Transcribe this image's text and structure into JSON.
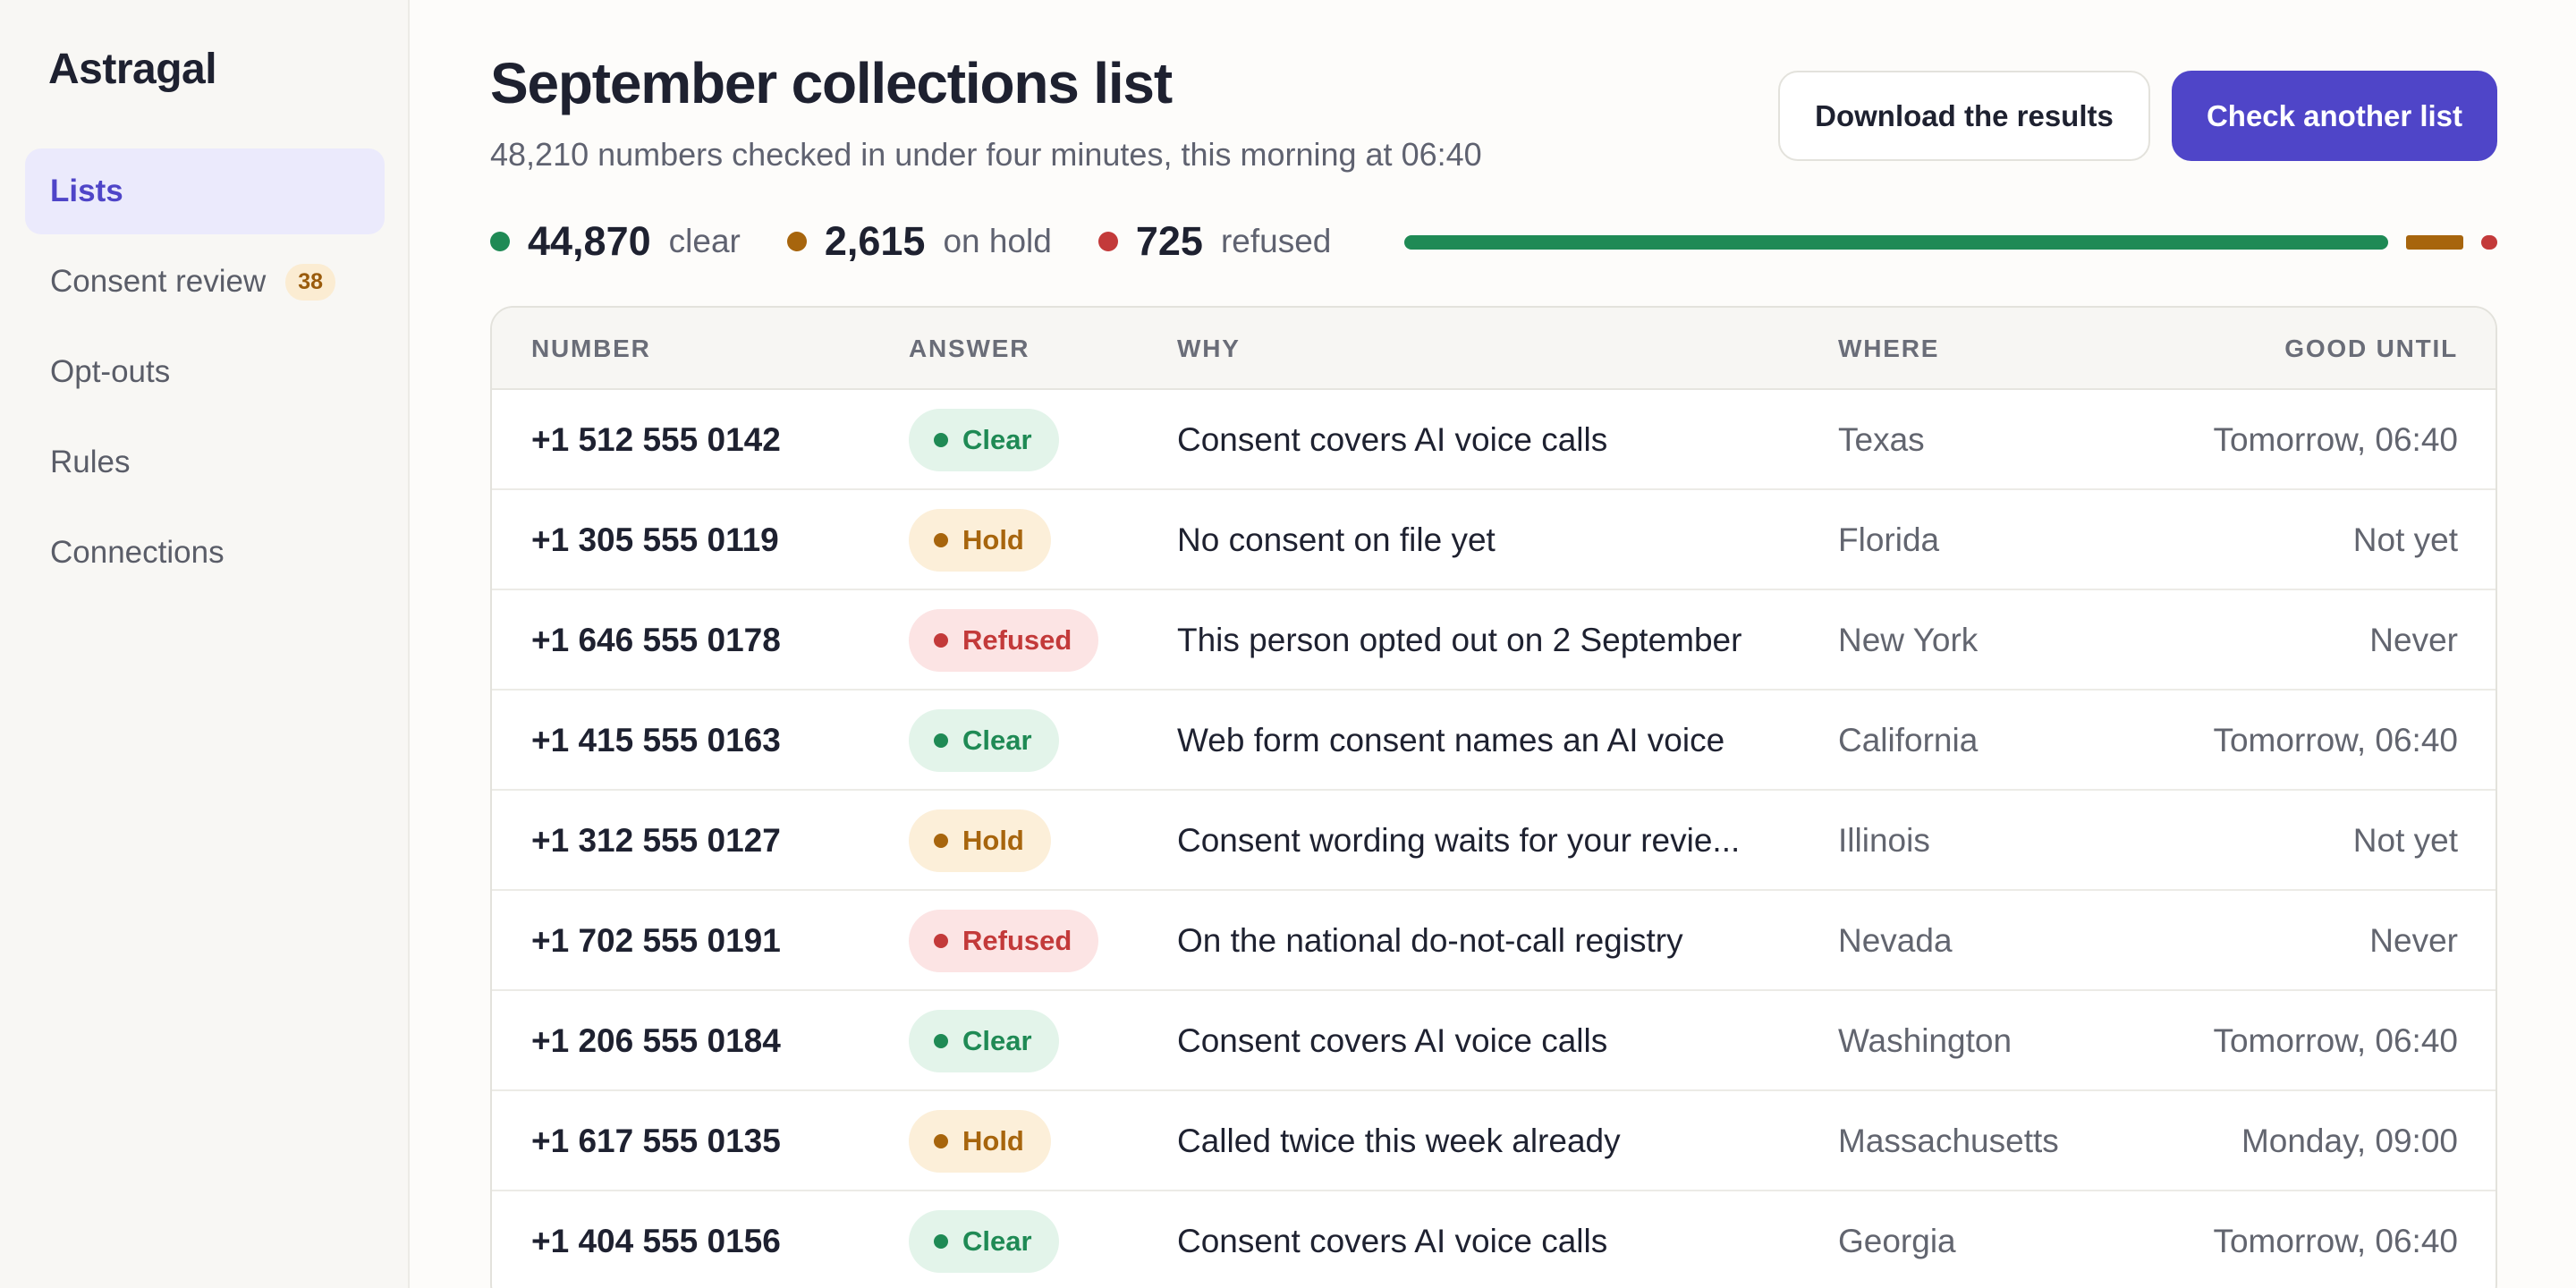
{
  "app": {
    "brand": "Astragal"
  },
  "sidebar": {
    "items": [
      {
        "label": "Lists",
        "active": true
      },
      {
        "label": "Consent review",
        "badge": "38"
      },
      {
        "label": "Opt-outs"
      },
      {
        "label": "Rules"
      },
      {
        "label": "Connections"
      }
    ]
  },
  "header": {
    "title": "September collections list",
    "subtitle": "48,210 numbers checked in under four minutes, this morning at 06:40",
    "download_label": "Download the results",
    "check_label": "Check another list"
  },
  "stats": {
    "clear": {
      "value": "44,870",
      "label": "clear",
      "count": 44870,
      "color": "#1f8a55"
    },
    "hold": {
      "value": "2,615",
      "label": "on hold",
      "count": 2615,
      "color": "#a7650d"
    },
    "refused": {
      "value": "725",
      "label": "refused",
      "count": 725,
      "color": "#c33a3a"
    }
  },
  "table": {
    "columns": {
      "number": "NUMBER",
      "answer": "ANSWER",
      "why": "WHY",
      "where": "WHERE",
      "until": "GOOD UNTIL"
    },
    "rows": [
      {
        "number": "+1 512 555 0142",
        "answer": "Clear",
        "status": "clear",
        "why": "Consent covers AI voice calls",
        "where": "Texas",
        "until": "Tomorrow, 06:40"
      },
      {
        "number": "+1 305 555 0119",
        "answer": "Hold",
        "status": "hold",
        "why": "No consent on file yet",
        "where": "Florida",
        "until": "Not yet"
      },
      {
        "number": "+1 646 555 0178",
        "answer": "Refused",
        "status": "refused",
        "why": "This person opted out on 2 September",
        "where": "New York",
        "until": "Never"
      },
      {
        "number": "+1 415 555 0163",
        "answer": "Clear",
        "status": "clear",
        "why": "Web form consent names an AI voice",
        "where": "California",
        "until": "Tomorrow, 06:40"
      },
      {
        "number": "+1 312 555 0127",
        "answer": "Hold",
        "status": "hold",
        "why": "Consent wording waits for your revie...",
        "where": "Illinois",
        "until": "Not yet"
      },
      {
        "number": "+1 702 555 0191",
        "answer": "Refused",
        "status": "refused",
        "why": "On the national do-not-call registry",
        "where": "Nevada",
        "until": "Never"
      },
      {
        "number": "+1 206 555 0184",
        "answer": "Clear",
        "status": "clear",
        "why": "Consent covers AI voice calls",
        "where": "Washington",
        "until": "Tomorrow, 06:40"
      },
      {
        "number": "+1 617 555 0135",
        "answer": "Hold",
        "status": "hold",
        "why": "Called twice this week already",
        "where": "Massachusetts",
        "until": "Monday, 09:00"
      },
      {
        "number": "+1 404 555 0156",
        "answer": "Clear",
        "status": "clear",
        "why": "Consent covers AI voice calls",
        "where": "Georgia",
        "until": "Tomorrow, 06:40"
      }
    ]
  }
}
